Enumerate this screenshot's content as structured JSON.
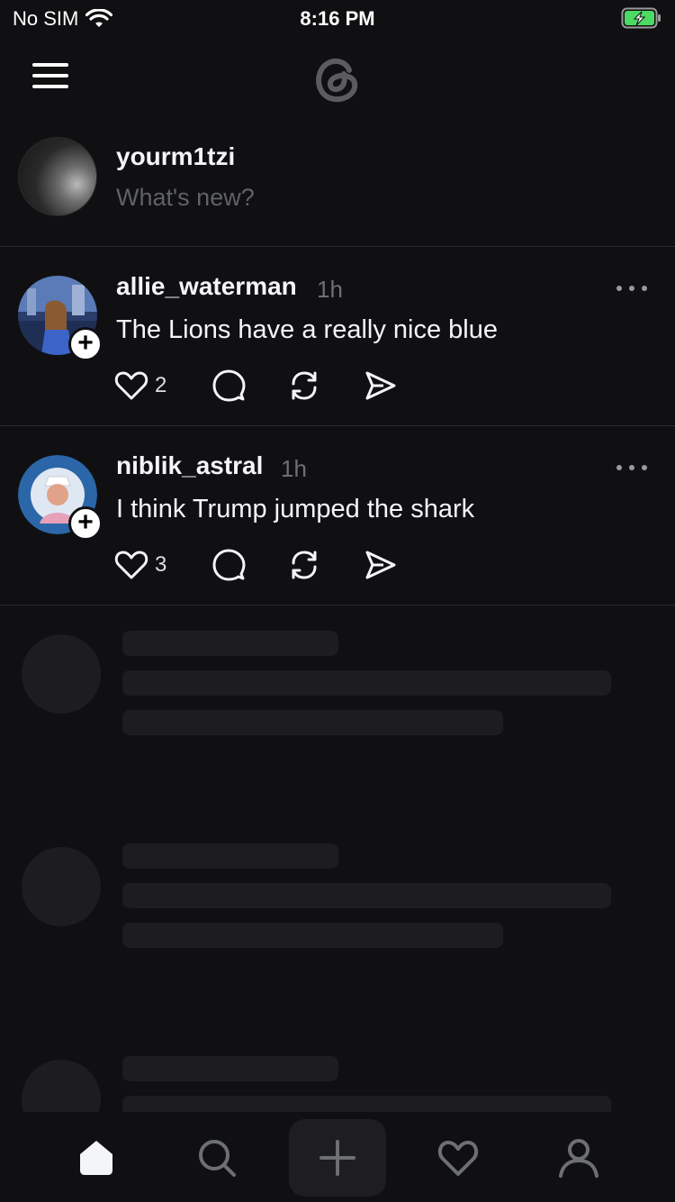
{
  "status_bar": {
    "carrier": "No SIM",
    "time": "8:16 PM"
  },
  "composer": {
    "username": "yourm1tzi",
    "placeholder": "What's new?"
  },
  "posts": [
    {
      "author": "allie_waterman",
      "time": "1h",
      "text": "The Lions have a really nice blue",
      "likes": "2"
    },
    {
      "author": "niblik_astral",
      "time": "1h",
      "text": "I think Trump jumped the shark",
      "likes": "3"
    }
  ],
  "colors": {
    "background": "#101012",
    "battery": "#4cd964",
    "skeleton": "#1d1d1f"
  },
  "tabs": [
    {
      "icon": "home-icon",
      "active": true
    },
    {
      "icon": "search-icon",
      "active": false
    },
    {
      "icon": "compose-icon",
      "active": false
    },
    {
      "icon": "heart-icon",
      "active": false
    },
    {
      "icon": "profile-icon",
      "active": false
    }
  ]
}
